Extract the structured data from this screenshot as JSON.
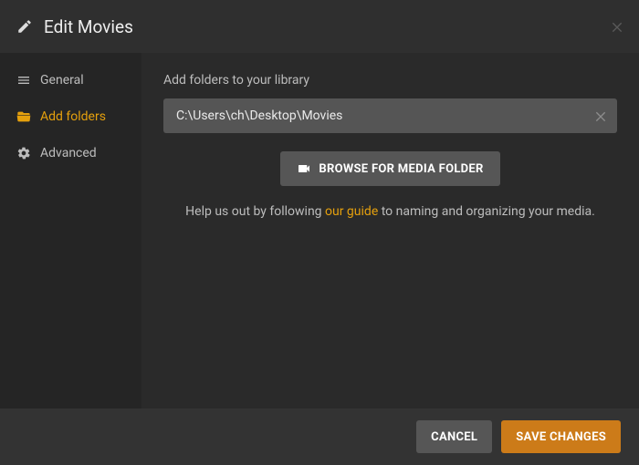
{
  "header": {
    "title": "Edit Movies"
  },
  "sidebar": {
    "items": [
      {
        "label": "General"
      },
      {
        "label": "Add folders"
      },
      {
        "label": "Advanced"
      }
    ]
  },
  "content": {
    "label": "Add folders to your library",
    "folder_path": "C:\\Users\\ch\\Desktop\\Movies",
    "browse_label": "BROWSE FOR MEDIA FOLDER",
    "help_prefix": "Help us out by following ",
    "help_link": "our guide",
    "help_suffix": " to naming and organizing your media."
  },
  "footer": {
    "cancel": "CANCEL",
    "save": "SAVE CHANGES"
  },
  "colors": {
    "accent": "#e5a00d",
    "primary_button": "#cc7b19"
  }
}
